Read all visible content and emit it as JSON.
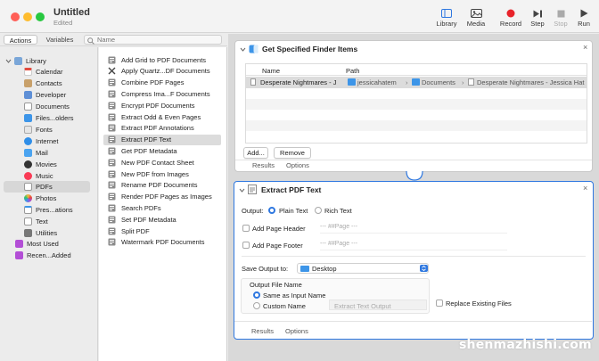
{
  "window": {
    "title": "Untitled",
    "subtitle": "Edited"
  },
  "toolbar": {
    "library_label": "Library",
    "media_label": "Media",
    "record_label": "Record",
    "step_label": "Step",
    "stop_label": "Stop",
    "run_label": "Run"
  },
  "left_tabs": {
    "actions": "Actions",
    "variables": "Variables"
  },
  "search": {
    "placeholder": "Name"
  },
  "library": {
    "root": "Library",
    "items": [
      "Calendar",
      "Contacts",
      "Developer",
      "Documents",
      "Files...olders",
      "Fonts",
      "Internet",
      "Mail",
      "Movies",
      "Music",
      "PDFs",
      "Photos",
      "Pres...ations",
      "Text",
      "Utilities"
    ],
    "selected": "PDFs",
    "extra": [
      "Most Used",
      "Recen...Added"
    ]
  },
  "actions": {
    "items": [
      "Add Grid to PDF Documents",
      "Apply Quartz...DF Documents",
      "Combine PDF Pages",
      "Compress Ima...F Documents",
      "Encrypt PDF Documents",
      "Extract Odd & Even Pages",
      "Extract PDF Annotations",
      "Extract PDF Text",
      "Get PDF Metadata",
      "New PDF Contact Sheet",
      "New PDF from Images",
      "Rename PDF Documents",
      "Render PDF Pages as Images",
      "Search PDFs",
      "Set PDF Metadata",
      "Split PDF",
      "Watermark PDF Documents"
    ],
    "selected": "Extract PDF Text"
  },
  "finder_panel": {
    "title": "Get Specified Finder Items",
    "col_name": "Name",
    "col_path": "Path",
    "row_name": "Desperate Nightmares - J",
    "path": [
      "jessicahatem",
      "Documents",
      "Desperate Nightmares - Jessica Hat"
    ],
    "add_button": "Add...",
    "remove_button": "Remove",
    "results_tab": "Results",
    "options_tab": "Options"
  },
  "extract_panel": {
    "title": "Extract PDF Text",
    "output_label": "Output:",
    "plain_text": "Plain Text",
    "rich_text": "Rich Text",
    "page_header": "Add Page Header",
    "page_footer": "Add Page Footer",
    "token_prefix": "---",
    "token": "##Page",
    "token_suffix": "---",
    "save_output_label": "Save Output to:",
    "save_location": "Desktop",
    "output_file_name": "Output File Name",
    "same_as_input": "Same as Input Name",
    "custom_name": "Custom Name",
    "custom_name_placeholder": "Extract Text Output",
    "replace_existing": "Replace Existing Files",
    "results_tab": "Results",
    "options_tab": "Options"
  },
  "watermark": "shenmazhishi.com",
  "colors": {
    "accent": "#2f78e0",
    "record": "#e8232a",
    "close": "#ff5f57",
    "minimize": "#febc2e",
    "zoom": "#28c840",
    "folder": "#3d95e8"
  }
}
